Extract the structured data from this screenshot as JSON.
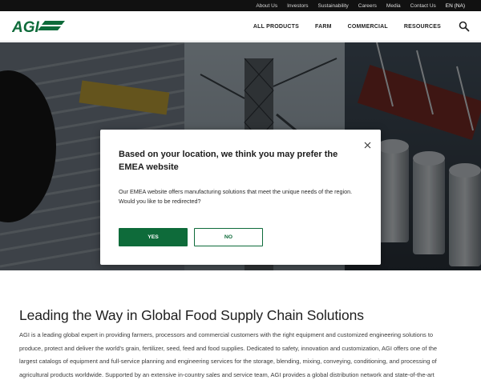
{
  "utility_nav": {
    "links": [
      "About Us",
      "Investors",
      "Sustainability",
      "Careers",
      "Media",
      "Contact Us"
    ],
    "language": "EN (NA)"
  },
  "header": {
    "logo_text": "AGI",
    "nav_items": [
      "ALL PRODUCTS",
      "FARM",
      "COMMERCIAL",
      "RESOURCES"
    ],
    "search_icon": "search-icon"
  },
  "modal": {
    "title": "Based on your location, we think you may prefer the EMEA website",
    "body_line1": "Our EMEA website offers manufacturing solutions that meet the unique needs of the region.",
    "body_line2": "Would you like to be redirected?",
    "yes_label": "YES",
    "no_label": "NO",
    "close_icon": "close-icon"
  },
  "main": {
    "heading": "Leading the Way in Global Food Supply Chain Solutions",
    "intro": "AGI is a leading global expert in providing farmers, processors and commercial customers with the right equipment and customized engineering solutions to produce, protect and deliver the world's grain, fertilizer, seed, feed and food supplies. Dedicated to safety, innovation and customization, AGI offers one of the largest catalogs of equipment and full-service planning and engineering services for the storage, blending, mixing, conveying, conditioning, and processing of agricultural products worldwide. Supported by an extensive in-country sales and service team, AGI provides a global distribution network and state-of-the-art manufacturing facilities in Canada, the United States, Brazil, India, France, and Italy."
  },
  "colors": {
    "brand_green": "#0e6b3a",
    "utility_bar": "#111111",
    "overlay": "rgba(0,0,0,0.5)"
  }
}
